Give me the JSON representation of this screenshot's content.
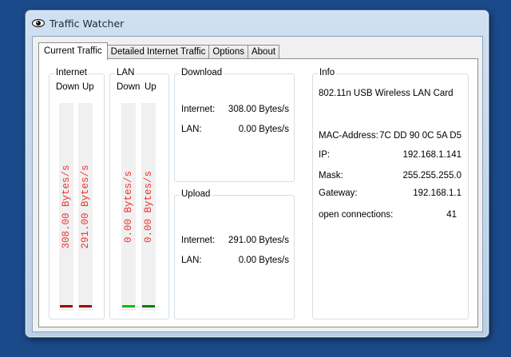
{
  "window": {
    "title": "Traffic Watcher"
  },
  "tabs": [
    {
      "label": "Current Traffic"
    },
    {
      "label": "Detailed Internet Traffic"
    },
    {
      "label": "Options"
    },
    {
      "label": "About"
    }
  ],
  "internet": {
    "label": "Internet",
    "down_label": "Down",
    "up_label": "Up",
    "down_value": "308.00 Bytes/s",
    "up_value": "291.00 Bytes/s",
    "bar_color": "#a00000"
  },
  "lan": {
    "label": "LAN",
    "down_label": "Down",
    "up_label": "Up",
    "down_value": "0.00 Bytes/s",
    "up_value": "0.00 Bytes/s",
    "down_bar_color": "#00c000",
    "up_bar_color": "#008000"
  },
  "download": {
    "label": "Download",
    "internet_label": "Internet:",
    "internet_value": "308.00 Bytes/s",
    "lan_label": "LAN:",
    "lan_value": "0.00 Bytes/s"
  },
  "upload": {
    "label": "Upload",
    "internet_label": "Internet:",
    "internet_value": "291.00 Bytes/s",
    "lan_label": "LAN:",
    "lan_value": "0.00 Bytes/s"
  },
  "info": {
    "label": "Info",
    "adapter": "802.11n USB Wireless LAN Card",
    "mac_label": "MAC-Address:",
    "mac_value": "7C DD 90 0C 5A D5",
    "ip_label": "IP:",
    "ip_value": "192.168.1.141",
    "mask_label": "Mask:",
    "mask_value": "255.255.255.0",
    "gateway_label": "Gateway:",
    "gateway_value": "192.168.1.1",
    "connections_label": "open connections:",
    "connections_value": "41"
  },
  "colors": {
    "desktop": "#1b4a8a",
    "meter_text": "#e33333"
  }
}
